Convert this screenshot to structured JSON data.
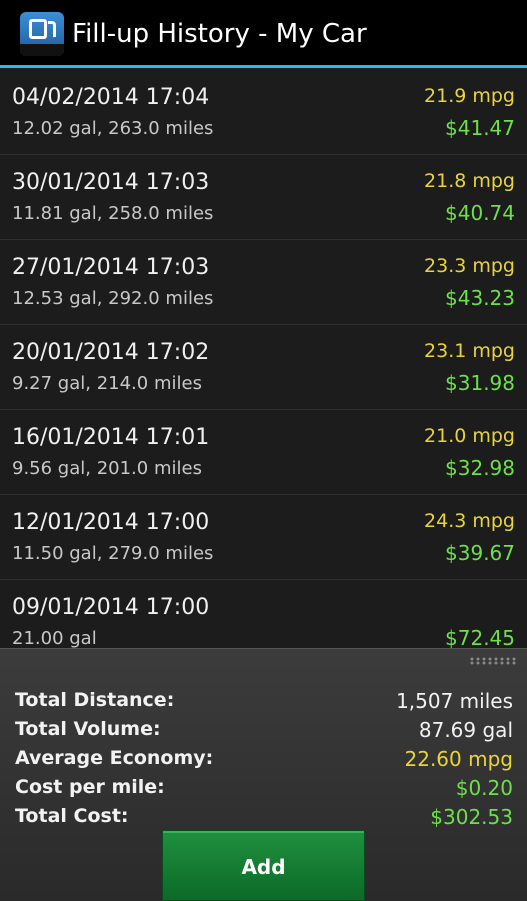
{
  "app": {
    "title": "Fill-up History - My Car",
    "icon": "fuel-pump-icon"
  },
  "entries": [
    {
      "date": "04/02/2014 17:04",
      "detail": "12.02 gal, 263.0 miles",
      "mpg": "21.9 mpg",
      "cost": "$41.47"
    },
    {
      "date": "30/01/2014 17:03",
      "detail": "11.81 gal, 258.0 miles",
      "mpg": "21.8 mpg",
      "cost": "$40.74"
    },
    {
      "date": "27/01/2014 17:03",
      "detail": "12.53 gal, 292.0 miles",
      "mpg": "23.3 mpg",
      "cost": "$43.23"
    },
    {
      "date": "20/01/2014 17:02",
      "detail": "9.27 gal, 214.0 miles",
      "mpg": "23.1 mpg",
      "cost": "$31.98"
    },
    {
      "date": "16/01/2014 17:01",
      "detail": "9.56 gal, 201.0 miles",
      "mpg": "21.0 mpg",
      "cost": "$32.98"
    },
    {
      "date": "12/01/2014 17:00",
      "detail": "11.50 gal, 279.0 miles",
      "mpg": "24.3 mpg",
      "cost": "$39.67"
    },
    {
      "date": "09/01/2014 17:00",
      "detail": "21.00 gal",
      "mpg": "",
      "cost": "$72.45"
    }
  ],
  "summary": {
    "total_distance_label": "Total Distance:",
    "total_distance_value": "1,507 miles",
    "total_volume_label": "Total Volume:",
    "total_volume_value": "87.69 gal",
    "average_economy_label": "Average Economy:",
    "average_economy_value": "22.60 mpg",
    "cost_per_mile_label": "Cost per mile:",
    "cost_per_mile_value": "$0.20",
    "total_cost_label": "Total Cost:",
    "total_cost_value": "$302.53"
  },
  "actions": {
    "add_label": "Add"
  },
  "colors": {
    "accent": "#33b5e5",
    "mpg": "#e8d43a",
    "cost": "#6ee04a",
    "button": "#1a7f36"
  }
}
